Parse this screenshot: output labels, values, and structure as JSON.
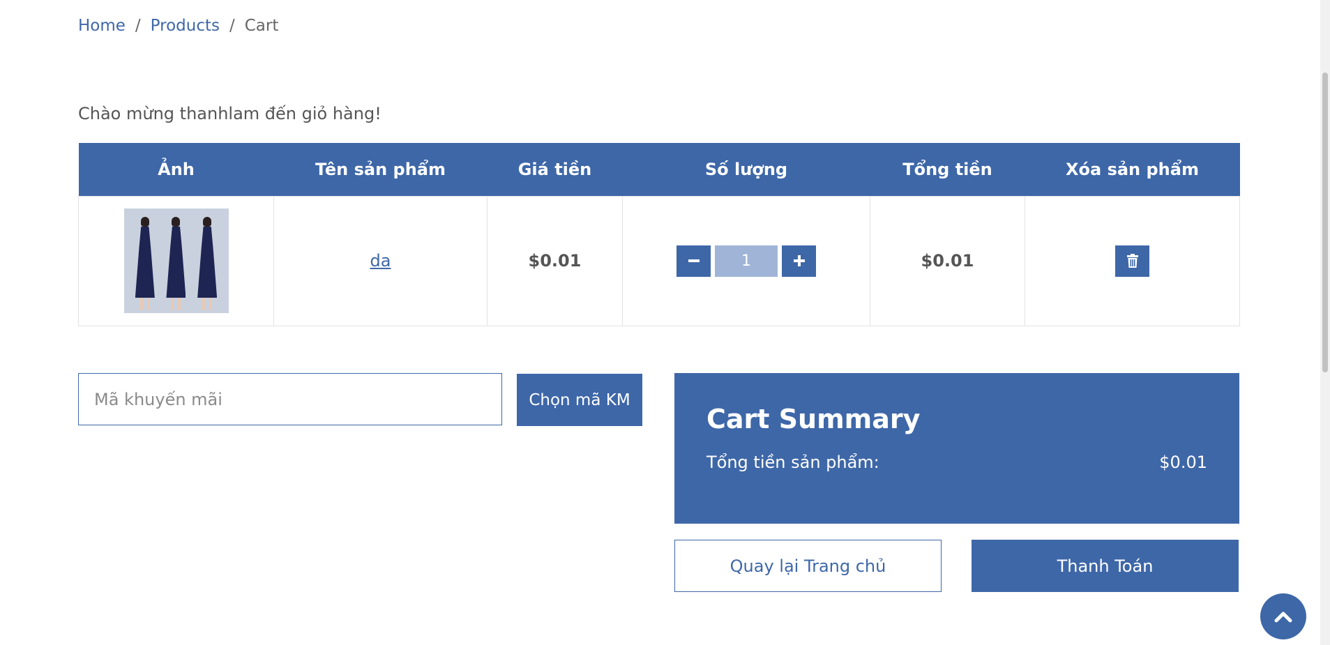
{
  "breadcrumb": {
    "home": "Home",
    "sep1": "/",
    "products": "Products",
    "sep2": "/",
    "current": "Cart"
  },
  "welcome_text": "Chào mừng thanhlam đến giỏ hàng!",
  "table": {
    "headers": [
      "Ảnh",
      "Tên sản phẩm",
      "Giá tiền",
      "Số lượng",
      "Tổng tiền",
      "Xóa sản phẩm"
    ],
    "rows": [
      {
        "image_icon": "product-photo-dress",
        "name": "da",
        "price": "$0.01",
        "quantity": "1",
        "total": "$0.01"
      }
    ]
  },
  "quantity_controls": {
    "decrease_icon": "minus-icon",
    "increase_icon": "plus-icon",
    "delete_icon": "trash-icon"
  },
  "promo": {
    "placeholder": "Mã khuyến mãi",
    "button_label": "Chọn mã KM"
  },
  "summary": {
    "title": "Cart Summary",
    "subtotal_label": "Tổng tiền sản phẩm:",
    "subtotal_value": "$0.01"
  },
  "actions": {
    "back_label": "Quay lại Trang chủ",
    "checkout_label": "Thanh Toán"
  },
  "back_to_top_icon": "chevron-up-icon",
  "colors": {
    "accent": "#3e67a8",
    "quantity_bg": "#9fb4d6"
  }
}
